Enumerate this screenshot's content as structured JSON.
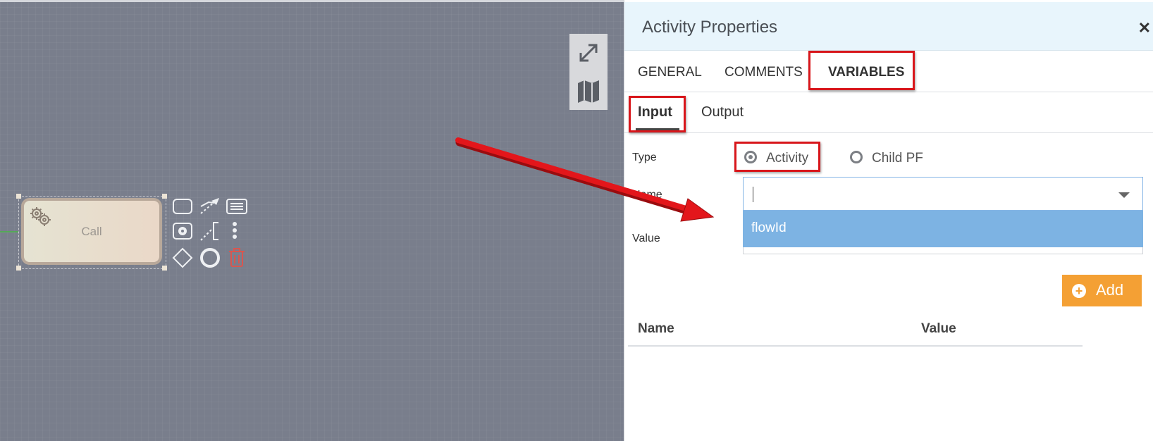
{
  "panel": {
    "title": "Activity Properties",
    "close_glyph": "✕"
  },
  "tabs": [
    {
      "label": "GENERAL"
    },
    {
      "label": "COMMENTS"
    },
    {
      "label": "VARIABLES"
    }
  ],
  "subtabs": [
    {
      "label": "Input"
    },
    {
      "label": "Output"
    }
  ],
  "form": {
    "type_label": "Type",
    "name_label": "Name",
    "value_label": "Value",
    "type_options": [
      {
        "label": "Activity",
        "selected": true
      },
      {
        "label": "Child PF",
        "selected": false
      }
    ],
    "name_value": "",
    "dropdown_options": [
      "flowId"
    ]
  },
  "add_button": {
    "label": "Add"
  },
  "table": {
    "columns": [
      "Name",
      "Value"
    ]
  },
  "canvas": {
    "node_label": "Call"
  },
  "icons": {
    "toolbox": [
      "expand-icon",
      "map-icon"
    ],
    "node": "gear-icon",
    "palette": [
      "task-icon",
      "association-icon",
      "data-list-icon",
      "subprocess-icon",
      "annotation-icon",
      "more-icon",
      "gateway-icon",
      "end-event-icon",
      "trash-icon"
    ]
  },
  "colors": {
    "canvas_bg": "#797e8c",
    "panel_header_bg": "#e8f5fc",
    "highlight_red": "#d8161b",
    "dropdown_selected": "#7db3e3",
    "add_button": "#f4a034"
  }
}
